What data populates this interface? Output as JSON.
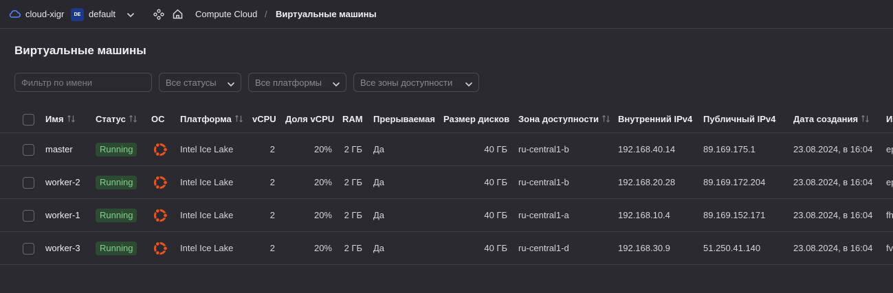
{
  "header": {
    "cloud_name": "cloud-xigr",
    "folder_badge": "DE",
    "folder_name": "default",
    "breadcrumb_service": "Compute Cloud",
    "breadcrumb_separator": "/",
    "breadcrumb_current": "Виртуальные машины"
  },
  "page": {
    "title": "Виртуальные машины"
  },
  "filters": {
    "name_placeholder": "Фильтр по имени",
    "status": "Все статусы",
    "platform": "Все платформы",
    "zone": "Все зоны доступности"
  },
  "table": {
    "columns": {
      "name": "Имя",
      "status": "Статус",
      "os": "ОС",
      "platform": "Платформа",
      "vcpu": "vCPU",
      "core_fraction": "Доля vCPU",
      "ram": "RAM",
      "preemptible": "Прерываемая",
      "disk_size": "Размер дисков",
      "zone": "Зона доступности",
      "internal_ip": "Внутренний IPv4",
      "public_ip": "Публичный IPv4",
      "created": "Дата создания",
      "next": "И"
    },
    "rows": [
      {
        "name": "master",
        "status": "Running",
        "os_icon": "ubuntu-icon",
        "platform": "Intel Ice Lake",
        "vcpu": "2",
        "core_fraction": "20%",
        "ram": "2 ГБ",
        "preemptible": "Да",
        "disk_size": "40 ГБ",
        "zone": "ru-central1-b",
        "internal_ip": "192.168.40.14",
        "public_ip": "89.169.175.1",
        "created": "23.08.2024, в 16:04",
        "next": "ep"
      },
      {
        "name": "worker-2",
        "status": "Running",
        "os_icon": "ubuntu-icon",
        "platform": "Intel Ice Lake",
        "vcpu": "2",
        "core_fraction": "20%",
        "ram": "2 ГБ",
        "preemptible": "Да",
        "disk_size": "40 ГБ",
        "zone": "ru-central1-b",
        "internal_ip": "192.168.20.28",
        "public_ip": "89.169.172.204",
        "created": "23.08.2024, в 16:04",
        "next": "ep"
      },
      {
        "name": "worker-1",
        "status": "Running",
        "os_icon": "ubuntu-icon",
        "platform": "Intel Ice Lake",
        "vcpu": "2",
        "core_fraction": "20%",
        "ram": "2 ГБ",
        "preemptible": "Да",
        "disk_size": "40 ГБ",
        "zone": "ru-central1-a",
        "internal_ip": "192.168.10.4",
        "public_ip": "89.169.152.171",
        "created": "23.08.2024, в 16:04",
        "next": "fh"
      },
      {
        "name": "worker-3",
        "status": "Running",
        "os_icon": "ubuntu-icon",
        "platform": "Intel Ice Lake",
        "vcpu": "2",
        "core_fraction": "20%",
        "ram": "2 ГБ",
        "preemptible": "Да",
        "disk_size": "40 ГБ",
        "zone": "ru-central1-d",
        "internal_ip": "192.168.30.9",
        "public_ip": "51.250.41.140",
        "created": "23.08.2024, в 16:04",
        "next": "fv"
      }
    ]
  },
  "colors": {
    "background": "#2a2a30",
    "status_running_bg": "#2d4a33",
    "status_running_text": "#7fd08c",
    "ubuntu_orange": "#e95420",
    "cloud_icon": "#5282ff"
  }
}
